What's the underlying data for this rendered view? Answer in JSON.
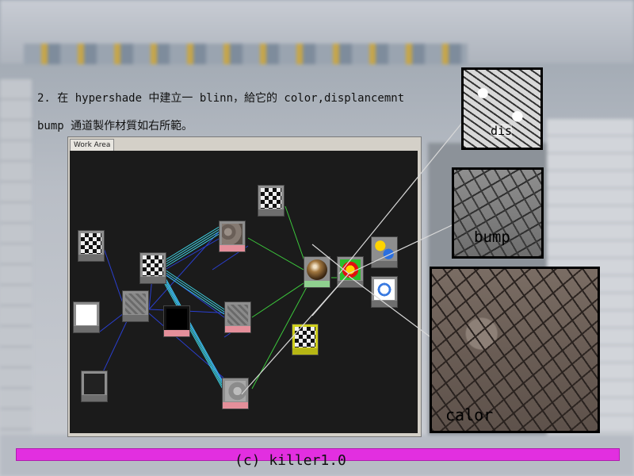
{
  "caption": {
    "line1": "2. 在 hypershade 中建立一 blinn，給它的 color,displancemnt",
    "line2": "bump 通道製作材質如右所範。"
  },
  "work_area": {
    "tab_label": "Work Area"
  },
  "callouts": {
    "dis_label": "dis",
    "bump_label": "bump",
    "color_label": "calor"
  },
  "footer": {
    "copyright": "(c) killer1.0"
  },
  "colors": {
    "accent_magenta": "#e22fe0",
    "canvas_bg": "#1b1b1b",
    "connection_cyan": "#3fd0e0",
    "connection_blue": "#2a3fd0",
    "connection_green": "#3cc83c",
    "callout_line": "#d8d8d8"
  }
}
